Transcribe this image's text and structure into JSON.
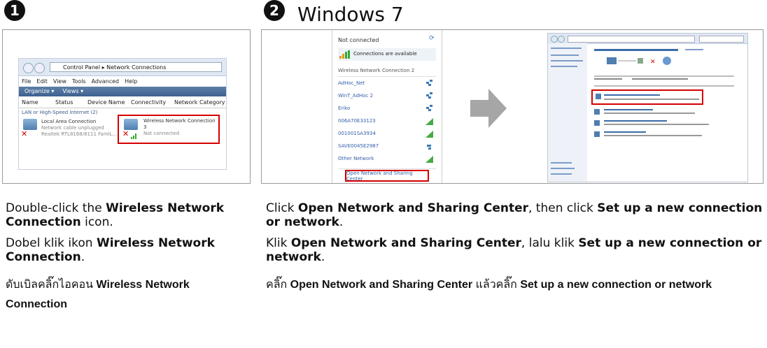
{
  "step1": {
    "number": "1",
    "screenshot": {
      "breadcrumb": "Control Panel ▸ Network Connections",
      "menu": [
        "File",
        "Edit",
        "View",
        "Tools",
        "Advanced",
        "Help"
      ],
      "toolbar": [
        "Organize ▾",
        "Views ▾"
      ],
      "columns": [
        "Name",
        "Status",
        "Device Name",
        "Connectivity",
        "Network Category"
      ],
      "group_label": "LAN or High-Speed Internet (2)",
      "local": {
        "title": "Local Area Connection",
        "line2": "Network cable unplugged",
        "line3": "Realtek RTL8168/8111 FamiL..."
      },
      "wireless": {
        "title": "Wireless Network Connection",
        "line2": "3",
        "line3": "Not connected"
      }
    },
    "en": {
      "pre": "Double-click the ",
      "bold": "Wireless Network Connection",
      "post": " icon."
    },
    "id": {
      "pre": "Dobel klik ikon ",
      "bold": "Wireless Network Connection",
      "post": "."
    },
    "th": {
      "pre": "ดับเบิลคลิ๊กไอคอน ",
      "bold1": "Wireless Network",
      "bold2": "Connection"
    }
  },
  "step2": {
    "number": "2",
    "heading": "Windows 7",
    "screenshot_left": {
      "status": "Not connected",
      "available": "Connections are available",
      "section": "Wireless Network Connection 2",
      "networks": [
        "AdHoc_Net",
        "WinT_AdHoc 2",
        "Eriko",
        "006A70E33123",
        "001001SA3934",
        "SAVE0045E2987",
        "Other Network"
      ],
      "button": "Open Network and Sharing Center"
    },
    "en": {
      "pre1": "Click ",
      "bold1": "Open Network and Sharing Center",
      "mid": ", then click ",
      "bold2": "Set up a new connection",
      "line2_bold": "or network",
      "end": "."
    },
    "id": {
      "pre1": "Klik ",
      "bold1": "Open Network and Sharing Center",
      "mid": ", lalu klik ",
      "bold2": "Set up a new connection or",
      "line2_bold": "network",
      "end": "."
    },
    "th": {
      "pre1": "คลิ๊ก ",
      "bold1": "Open Network and Sharing Center",
      "mid": " แล้วคลิ๊ก ",
      "bold2": "Set up a new connection or network"
    }
  },
  "colors": {
    "highlight": "#d40000",
    "arrow": "#a6a6a6",
    "titlebar": "#dfe8f4"
  }
}
